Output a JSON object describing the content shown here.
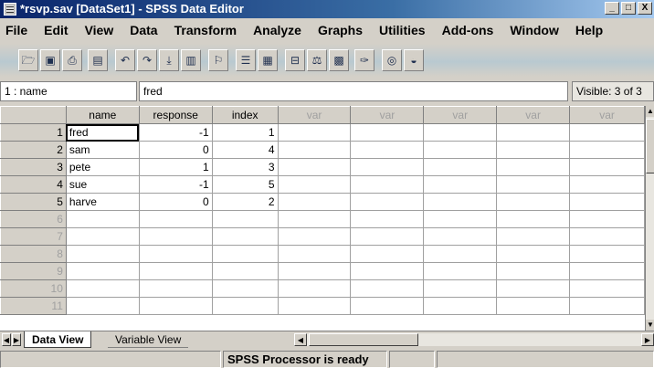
{
  "window": {
    "title": "*rsvp.sav [DataSet1] - SPSS Data Editor",
    "controls": [
      "_",
      "□",
      "X"
    ]
  },
  "menu": [
    "File",
    "Edit",
    "View",
    "Data",
    "Transform",
    "Analyze",
    "Graphs",
    "Utilities",
    "Add-ons",
    "Window",
    "Help"
  ],
  "toolbar": {
    "icons": [
      "open-icon",
      "save-icon",
      "print-icon",
      "dialog-recall-icon",
      "undo-icon",
      "redo-icon",
      "goto-case-icon",
      "variables-icon",
      "find-icon",
      "insert-cases-icon",
      "insert-variable-icon",
      "split-file-icon",
      "weight-cases-icon",
      "select-cases-icon",
      "value-labels-icon",
      "use-sets-icon",
      "show-all-icon"
    ]
  },
  "cell_editor": {
    "reference": "1 : name",
    "value": "fred",
    "visible": "Visible: 3 of 3"
  },
  "grid": {
    "columns": [
      "name",
      "response",
      "index",
      "var",
      "var",
      "var",
      "var",
      "var"
    ],
    "rows": [
      {
        "num": "1",
        "name": "fred",
        "response": "-1",
        "index": "1"
      },
      {
        "num": "2",
        "name": "sam",
        "response": "0",
        "index": "4"
      },
      {
        "num": "3",
        "name": "pete",
        "response": "1",
        "index": "3"
      },
      {
        "num": "4",
        "name": "sue",
        "response": "-1",
        "index": "5"
      },
      {
        "num": "5",
        "name": "harve",
        "response": "0",
        "index": "2"
      },
      {
        "num": "6",
        "name": "",
        "response": "",
        "index": ""
      },
      {
        "num": "7",
        "name": "",
        "response": "",
        "index": ""
      },
      {
        "num": "8",
        "name": "",
        "response": "",
        "index": ""
      },
      {
        "num": "9",
        "name": "",
        "response": "",
        "index": ""
      },
      {
        "num": "10",
        "name": "",
        "response": "",
        "index": ""
      },
      {
        "num": "11",
        "name": "",
        "response": "",
        "index": ""
      }
    ]
  },
  "tabs": {
    "data_view": "Data View",
    "variable_view": "Variable View"
  },
  "status": {
    "processor": "SPSS Processor is ready"
  }
}
